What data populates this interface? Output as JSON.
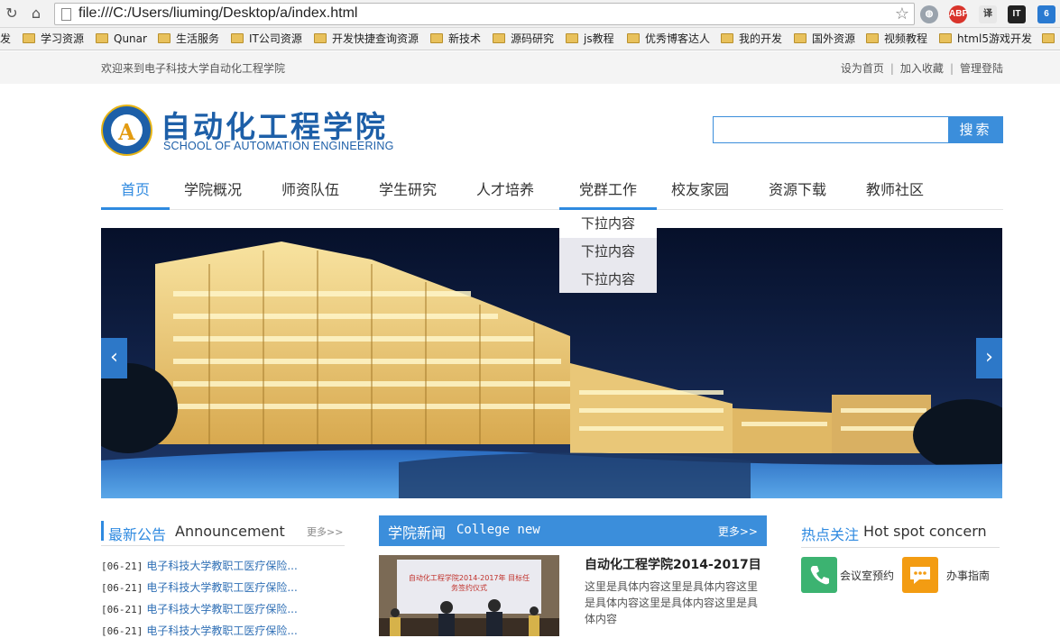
{
  "browser": {
    "url": "file:///C:/Users/liuming/Desktop/a/index.html",
    "extensions": [
      "globe-icon",
      "abp-icon",
      "translate-icon",
      "it-icon",
      "script-icon"
    ],
    "bookmarks": [
      "发",
      "学习资源",
      "Qunar",
      "生活服务",
      "IT公司资源",
      "开发快捷查询资源",
      "新技术",
      "源码研究",
      "js教程",
      "优秀博客达人",
      "我的开发",
      "国外资源",
      "视频教程",
      "html5游戏开发"
    ]
  },
  "topbar": {
    "welcome": "欢迎来到电子科技大学自动化工程学院",
    "links": [
      "设为首页",
      "加入收藏",
      "管理登陆"
    ]
  },
  "logo": {
    "letter": "A",
    "cn": "自动化工程学院",
    "en": "SCHOOL OF AUTOMATION ENGINEERING"
  },
  "search": {
    "placeholder": "",
    "button": "搜索"
  },
  "nav": {
    "items": [
      "首页",
      "学院概况",
      "师资队伍",
      "学生研究",
      "人才培养",
      "党群工作",
      "校友家园",
      "资源下载",
      "教师社区"
    ],
    "active_index": 0,
    "hover_index": 5,
    "dropdown": [
      "下拉内容",
      "下拉内容",
      "下拉内容"
    ]
  },
  "banner": {
    "prev": "‹",
    "next": "›"
  },
  "notices": {
    "title_cn": "最新公告",
    "title_en": "Announcement",
    "more": "更多>>",
    "items": [
      {
        "date": "[06-21]",
        "title": "电子科技大学教职工医疗保险..."
      },
      {
        "date": "[06-21]",
        "title": "电子科技大学教职工医疗保险..."
      },
      {
        "date": "[06-21]",
        "title": "电子科技大学教职工医疗保险..."
      },
      {
        "date": "[06-21]",
        "title": "电子科技大学教职工医疗保险..."
      }
    ]
  },
  "news": {
    "title_cn": "学院新闻",
    "title_en": "College new",
    "more": "更多>>",
    "image_caption": "自动化工程学院2014-2017年 目标任务签约仪式",
    "headline": "自动化工程学院2014-2017目",
    "body": "这里是具体内容这里是具体内容这里是具体内容这里是具体内容这里是具体内容"
  },
  "hotspot": {
    "title_cn": "热点关注",
    "title_en": "Hot spot concern",
    "items": [
      {
        "label": "会议室预约",
        "icon": "phone-icon",
        "color": "#3cb371"
      },
      {
        "label": "办事指南",
        "icon": "chat-icon",
        "color": "#f39c12"
      }
    ]
  },
  "colors": {
    "accent": "#2f8ae0",
    "logo_blue": "#1d5fa8",
    "logo_gold": "#e7b414"
  }
}
